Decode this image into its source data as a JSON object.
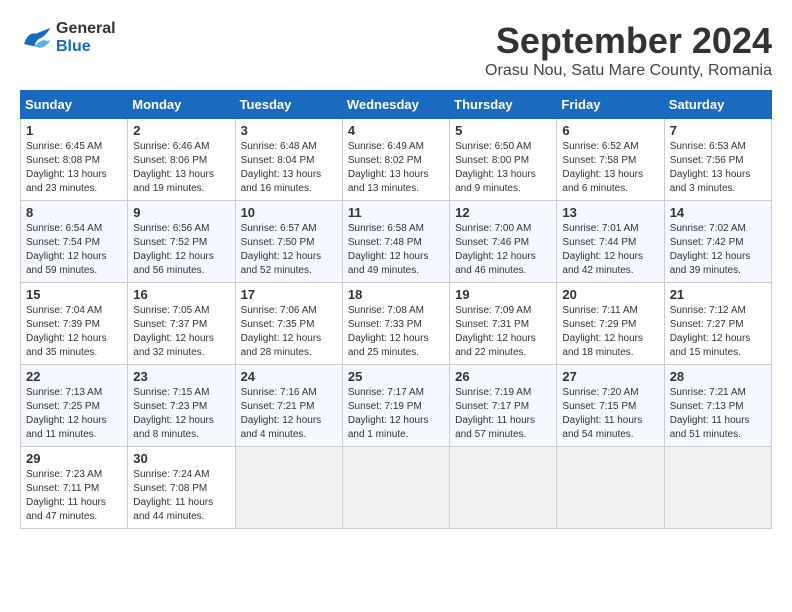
{
  "logo": {
    "line1": "General",
    "line2": "Blue"
  },
  "title": "September 2024",
  "location": "Orasu Nou, Satu Mare County, Romania",
  "weekdays": [
    "Sunday",
    "Monday",
    "Tuesday",
    "Wednesday",
    "Thursday",
    "Friday",
    "Saturday"
  ],
  "weeks": [
    [
      {
        "day": "1",
        "info": "Sunrise: 6:45 AM\nSunset: 8:08 PM\nDaylight: 13 hours\nand 23 minutes."
      },
      {
        "day": "2",
        "info": "Sunrise: 6:46 AM\nSunset: 8:06 PM\nDaylight: 13 hours\nand 19 minutes."
      },
      {
        "day": "3",
        "info": "Sunrise: 6:48 AM\nSunset: 8:04 PM\nDaylight: 13 hours\nand 16 minutes."
      },
      {
        "day": "4",
        "info": "Sunrise: 6:49 AM\nSunset: 8:02 PM\nDaylight: 13 hours\nand 13 minutes."
      },
      {
        "day": "5",
        "info": "Sunrise: 6:50 AM\nSunset: 8:00 PM\nDaylight: 13 hours\nand 9 minutes."
      },
      {
        "day": "6",
        "info": "Sunrise: 6:52 AM\nSunset: 7:58 PM\nDaylight: 13 hours\nand 6 minutes."
      },
      {
        "day": "7",
        "info": "Sunrise: 6:53 AM\nSunset: 7:56 PM\nDaylight: 13 hours\nand 3 minutes."
      }
    ],
    [
      {
        "day": "8",
        "info": "Sunrise: 6:54 AM\nSunset: 7:54 PM\nDaylight: 12 hours\nand 59 minutes."
      },
      {
        "day": "9",
        "info": "Sunrise: 6:56 AM\nSunset: 7:52 PM\nDaylight: 12 hours\nand 56 minutes."
      },
      {
        "day": "10",
        "info": "Sunrise: 6:57 AM\nSunset: 7:50 PM\nDaylight: 12 hours\nand 52 minutes."
      },
      {
        "day": "11",
        "info": "Sunrise: 6:58 AM\nSunset: 7:48 PM\nDaylight: 12 hours\nand 49 minutes."
      },
      {
        "day": "12",
        "info": "Sunrise: 7:00 AM\nSunset: 7:46 PM\nDaylight: 12 hours\nand 46 minutes."
      },
      {
        "day": "13",
        "info": "Sunrise: 7:01 AM\nSunset: 7:44 PM\nDaylight: 12 hours\nand 42 minutes."
      },
      {
        "day": "14",
        "info": "Sunrise: 7:02 AM\nSunset: 7:42 PM\nDaylight: 12 hours\nand 39 minutes."
      }
    ],
    [
      {
        "day": "15",
        "info": "Sunrise: 7:04 AM\nSunset: 7:39 PM\nDaylight: 12 hours\nand 35 minutes."
      },
      {
        "day": "16",
        "info": "Sunrise: 7:05 AM\nSunset: 7:37 PM\nDaylight: 12 hours\nand 32 minutes."
      },
      {
        "day": "17",
        "info": "Sunrise: 7:06 AM\nSunset: 7:35 PM\nDaylight: 12 hours\nand 28 minutes."
      },
      {
        "day": "18",
        "info": "Sunrise: 7:08 AM\nSunset: 7:33 PM\nDaylight: 12 hours\nand 25 minutes."
      },
      {
        "day": "19",
        "info": "Sunrise: 7:09 AM\nSunset: 7:31 PM\nDaylight: 12 hours\nand 22 minutes."
      },
      {
        "day": "20",
        "info": "Sunrise: 7:11 AM\nSunset: 7:29 PM\nDaylight: 12 hours\nand 18 minutes."
      },
      {
        "day": "21",
        "info": "Sunrise: 7:12 AM\nSunset: 7:27 PM\nDaylight: 12 hours\nand 15 minutes."
      }
    ],
    [
      {
        "day": "22",
        "info": "Sunrise: 7:13 AM\nSunset: 7:25 PM\nDaylight: 12 hours\nand 11 minutes."
      },
      {
        "day": "23",
        "info": "Sunrise: 7:15 AM\nSunset: 7:23 PM\nDaylight: 12 hours\nand 8 minutes."
      },
      {
        "day": "24",
        "info": "Sunrise: 7:16 AM\nSunset: 7:21 PM\nDaylight: 12 hours\nand 4 minutes."
      },
      {
        "day": "25",
        "info": "Sunrise: 7:17 AM\nSunset: 7:19 PM\nDaylight: 12 hours\nand 1 minute."
      },
      {
        "day": "26",
        "info": "Sunrise: 7:19 AM\nSunset: 7:17 PM\nDaylight: 11 hours\nand 57 minutes."
      },
      {
        "day": "27",
        "info": "Sunrise: 7:20 AM\nSunset: 7:15 PM\nDaylight: 11 hours\nand 54 minutes."
      },
      {
        "day": "28",
        "info": "Sunrise: 7:21 AM\nSunset: 7:13 PM\nDaylight: 11 hours\nand 51 minutes."
      }
    ],
    [
      {
        "day": "29",
        "info": "Sunrise: 7:23 AM\nSunset: 7:11 PM\nDaylight: 11 hours\nand 47 minutes."
      },
      {
        "day": "30",
        "info": "Sunrise: 7:24 AM\nSunset: 7:08 PM\nDaylight: 11 hours\nand 44 minutes."
      },
      {
        "day": "",
        "info": ""
      },
      {
        "day": "",
        "info": ""
      },
      {
        "day": "",
        "info": ""
      },
      {
        "day": "",
        "info": ""
      },
      {
        "day": "",
        "info": ""
      }
    ]
  ]
}
